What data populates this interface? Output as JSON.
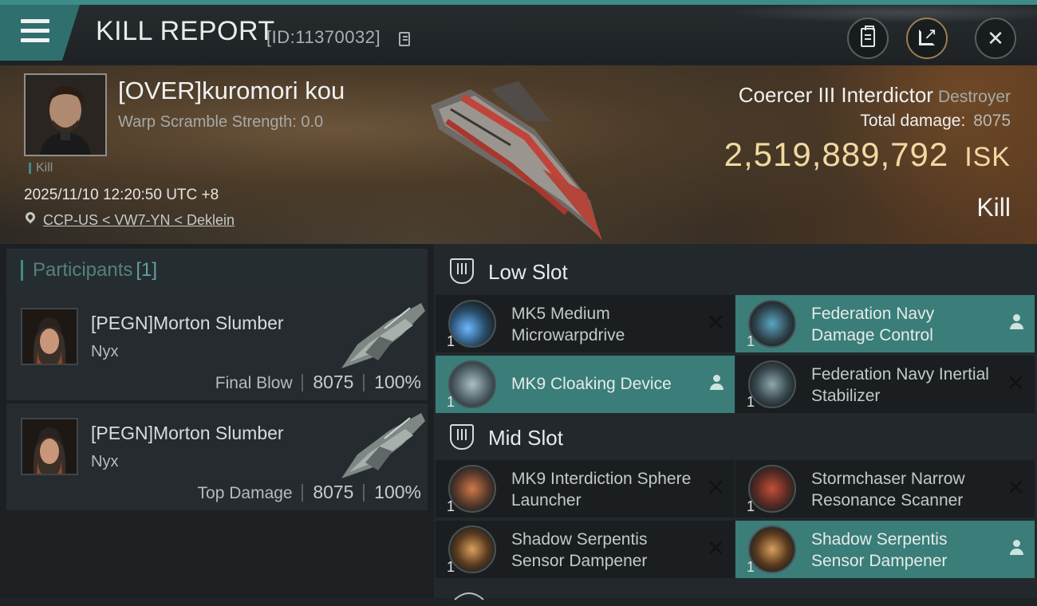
{
  "header": {
    "title": "KILL REPORT",
    "report_id": "[ID:11370032]",
    "icons": [
      "menu-icon",
      "copy-icon",
      "clipboard-icon",
      "share-icon",
      "close-icon"
    ]
  },
  "victim": {
    "name": "[OVER]kuromori kou",
    "warp_scramble": "Warp Scramble Strength: 0.0",
    "tag": "Kill",
    "datetime": "2025/11/10 12:20:50 UTC +8",
    "location": "CCP-US < VW7-YN < Deklein",
    "ship_name": "Coercer III Interdictor",
    "ship_class": "Destroyer",
    "total_damage_label": "Total damage:",
    "total_damage": "8075",
    "isk_value": "2,519,889,792",
    "isk_unit": "ISK",
    "result": "Kill"
  },
  "participants": {
    "label": "Participants",
    "count": "[1]",
    "items": [
      {
        "name": "[PEGN]Morton Slumber",
        "ship": "Nyx",
        "role": "Final Blow",
        "damage": "8075",
        "percent": "100%"
      },
      {
        "name": "[PEGN]Morton Slumber",
        "ship": "Nyx",
        "role": "Top Damage",
        "damage": "8075",
        "percent": "100%"
      }
    ]
  },
  "slots": {
    "low": {
      "title": "Low Slot",
      "modules": [
        {
          "name": "MK5 Medium Microwarpdrive",
          "qty": "1",
          "state": "destroyed"
        },
        {
          "name": "Federation Navy Damage Control",
          "qty": "1",
          "state": "dropped"
        },
        {
          "name": "MK9 Cloaking Device",
          "qty": "1",
          "state": "dropped"
        },
        {
          "name": "Federation Navy Inertial Stabilizer",
          "qty": "1",
          "state": "destroyed"
        }
      ]
    },
    "mid": {
      "title": "Mid Slot",
      "modules": [
        {
          "name": "MK9 Interdiction Sphere Launcher",
          "qty": "1",
          "state": "destroyed"
        },
        {
          "name": "Stormchaser Narrow Resonance Scanner",
          "qty": "1",
          "state": "destroyed"
        },
        {
          "name": "Shadow Serpentis Sensor Dampener",
          "qty": "1",
          "state": "destroyed"
        },
        {
          "name": "Shadow Serpentis Sensor Dampener",
          "qty": "1",
          "state": "dropped"
        }
      ]
    }
  },
  "colors": {
    "accent": "#3e8c8a",
    "highlight_row": "#3b7d78",
    "isk_gold": "#f1d9a0"
  }
}
